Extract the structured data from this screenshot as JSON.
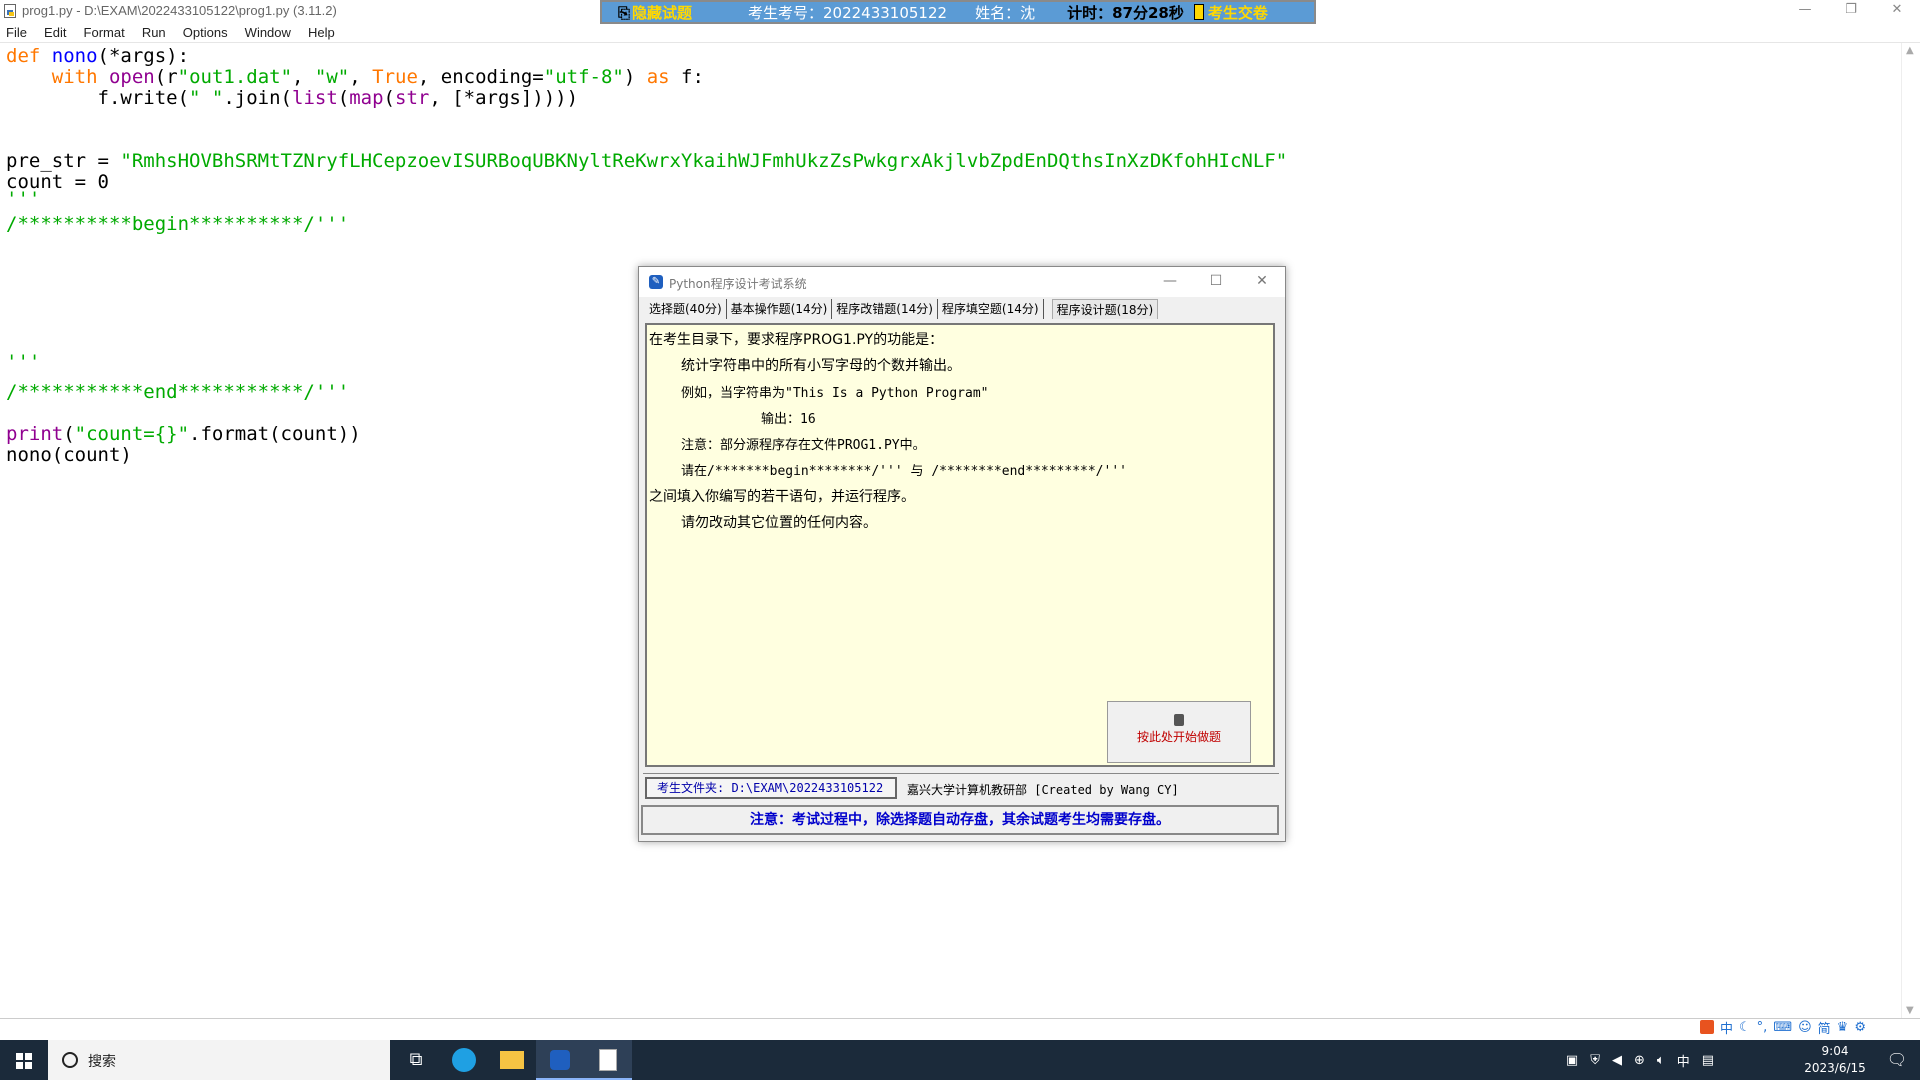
{
  "window": {
    "title": "prog1.py - D:\\EXAM\\2022433105122\\prog1.py (3.11.2)",
    "controls": [
      "—",
      "❐",
      "✕"
    ]
  },
  "menu": [
    "File",
    "Edit",
    "Format",
    "Run",
    "Options",
    "Window",
    "Help"
  ],
  "exam_banner": {
    "hide_label": "隐藏试题",
    "student_id": "考生考号：2022433105122",
    "name": "姓名：沈",
    "timer": "计时：87分28秒",
    "submit_label": "考生交卷"
  },
  "editor": {
    "lines": [
      {
        "t": "def nono(*args):"
      },
      {
        "t": "    with open(r\"out1.dat\", \"w\", True, encoding=\"utf-8\") as f:"
      },
      {
        "t": "        f.write(\" \".join(list(map(str, [*args]))))"
      },
      {
        "t": ""
      },
      {
        "t": ""
      },
      {
        "t": "pre_str = \"RmhsHOVBhSRMtTZNryfLHCepzoevISURBoqUBKNyltReKwrxYkaihWJFmhUkzZsPwkgrxAkjlvbZpdEnDQthsInXzDKfohHIcNLF\""
      },
      {
        "t": "count = 0"
      },
      {
        "t": "'''"
      },
      {
        "t": "/**********begin**********/'''"
      },
      {
        "t": "'''"
      },
      {
        "t": "/***********end***********/'''"
      },
      {
        "t": "print(\"count={}\".format(count))"
      },
      {
        "t": "nono(count)"
      }
    ]
  },
  "dialog": {
    "title": "Python程序设计考试系统",
    "tabs": [
      "选择题(40分)",
      "基本操作题(14分)",
      "程序改错题(14分)",
      "程序填空题(14分)",
      "程序设计题(18分)"
    ],
    "active_tab": 4,
    "content": [
      "在考生目录下，要求程序PROG1.PY的功能是：",
      "统计字符串中的所有小写字母的个数并输出。",
      "例如，当字符串为\"This Is a Python Program\"",
      "输出：16",
      "注意：部分源程序存在文件PROG1.PY中。",
      "请在/*******begin********/''' 与 /********end*********/'''",
      "之间填入你编写的若干语句，并运行程序。",
      "请勿改动其它位置的任何内容。"
    ],
    "start_button": "按此处开始做题",
    "folder_label": "考生文件夹: D:\\EXAM\\2022433105122",
    "credit": "嘉兴大学计算机教研部 [Created by Wang CY]",
    "notice": "注意：考试过程中，除选择题自动存盘，其余试题考生均需要存盘。"
  },
  "taskbar": {
    "search_label": "搜索",
    "clock_time": "9:04",
    "clock_date": "2023/6/15",
    "ime_lang": "中",
    "ime_mode": "简"
  }
}
